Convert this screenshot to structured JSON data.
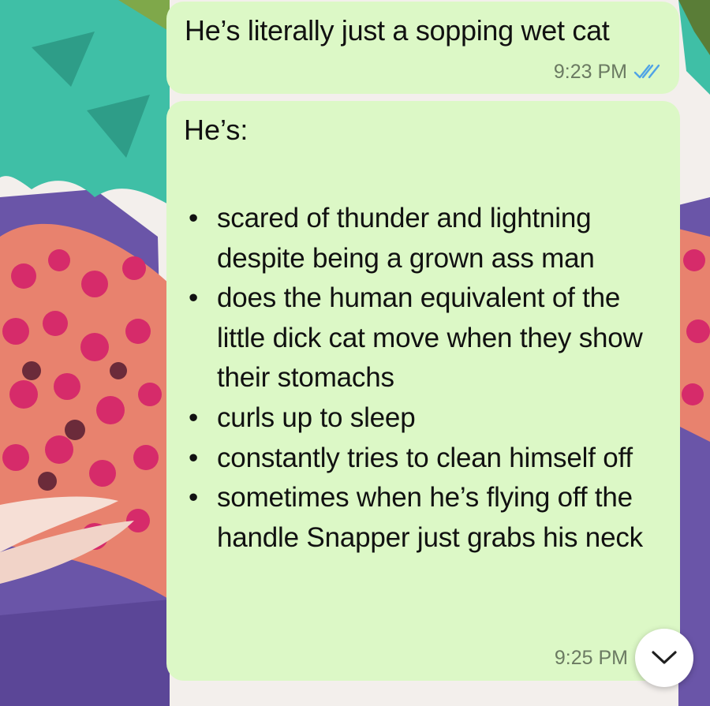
{
  "chat": {
    "messages": [
      {
        "text": "He’s literally just a sopping wet cat",
        "time": "9:23 PM",
        "status_icon": "double-check-read-icon"
      },
      {
        "heading": "He’s:",
        "bullets": [
          "scared of thunder and lightning despite being a grown ass man",
          "does the human equivalent of the little dick cat move when they show their stomachs",
          "curls up to sleep",
          "constantly tries to clean himself off",
          "sometimes when he’s flying off the handle Snapper just grabs his neck"
        ],
        "time": "9:25 PM"
      }
    ]
  },
  "ui": {
    "bullet_glyph": "•",
    "scroll_button_icon": "chevron-down-icon"
  },
  "colors": {
    "outgoing_bubble": "#dcf8c6",
    "read_ticks": "#4fa3e6",
    "timestamp": "#6b7a62",
    "wallpaper_hair": "#3fbfa6",
    "wallpaper_scarf": "#e8826e",
    "wallpaper_dots": "#d62b6a",
    "wallpaper_jacket": "#6a55a8"
  }
}
